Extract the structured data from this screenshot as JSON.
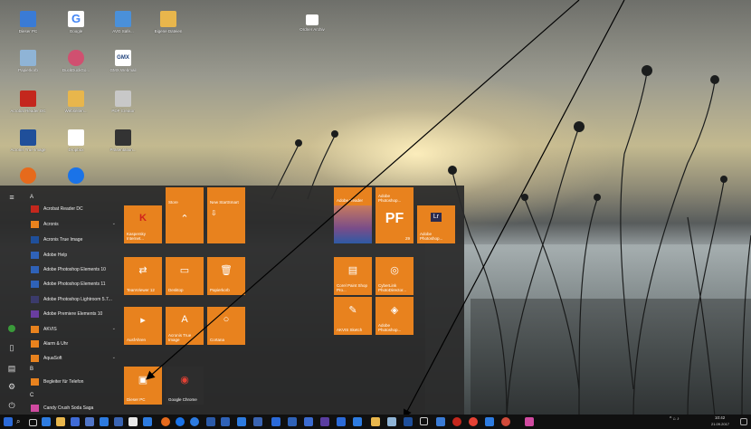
{
  "desktop": {
    "icons": [
      {
        "label": "Dieser PC",
        "color": "#3a7bd5"
      },
      {
        "label": "Google",
        "color": "#ffffff"
      },
      {
        "label": "AVG Safe...",
        "color": "#4a90d9"
      },
      {
        "label": "Eigene Dateien",
        "color": "#e8b64c"
      },
      {
        "label": "Papierkorb",
        "color": "#8fb4d6"
      },
      {
        "label": "DuckDuckGo...",
        "color": "#d05070"
      },
      {
        "label": "GMX Webmail",
        "color": "#ffffff"
      },
      {
        "label": "Acrobat Reader DC",
        "color": "#c4271d"
      },
      {
        "label": "Webseiten...",
        "color": "#e8b64c"
      },
      {
        "label": "PDF Creator",
        "color": "#c8c8c8"
      },
      {
        "label": "Acronis True Image",
        "color": "#1f4f9a"
      },
      {
        "label": "Dropbox",
        "color": "#ffffff"
      },
      {
        "label": "Präsentation...",
        "color": "#333333"
      },
      {
        "label": "Firefox",
        "color": "#e66a1c"
      },
      {
        "label": "TeamViewer",
        "color": "#1a73e8"
      },
      {
        "label": "Ordner Archiv",
        "color": "#ffffff"
      }
    ]
  },
  "start_menu": {
    "letter_a": "A",
    "letter_b": "B",
    "letter_c": "C",
    "apps": [
      {
        "label": "Acrobat Reader DC",
        "chevron": ""
      },
      {
        "label": "Acronis",
        "chevron": "⌄"
      },
      {
        "label": "Acronis True Image",
        "chevron": ""
      },
      {
        "label": "Adobe Help",
        "chevron": ""
      },
      {
        "label": "Adobe Photoshop Elements 10",
        "chevron": ""
      },
      {
        "label": "Adobe Photoshop Elements 11",
        "chevron": ""
      },
      {
        "label": "Adobe Photoshop Lightroom 5.7...",
        "chevron": ""
      },
      {
        "label": "Adobe Premiere Elements 10",
        "chevron": ""
      },
      {
        "label": "AKVIS",
        "chevron": "⌄"
      },
      {
        "label": "Alarm & Uhr",
        "chevron": ""
      },
      {
        "label": "AquaSoft",
        "chevron": "⌄"
      },
      {
        "label": "Begleiter für Telefon",
        "chevron": ""
      },
      {
        "label": "Candy Crush Soda Saga",
        "chevron": ""
      }
    ],
    "tiles": [
      {
        "label": "Store",
        "glyph": ""
      },
      {
        "label": "New StartSmart",
        "glyph": ""
      },
      {
        "label": "Kaspersky Internet...",
        "glyph": "K"
      },
      {
        "label": "",
        "glyph": "⌃"
      },
      {
        "label": "",
        "glyph": "⇩"
      },
      {
        "label": "TeamViewer 12",
        "glyph": "⇄"
      },
      {
        "label": "Desktop",
        "glyph": "▭"
      },
      {
        "label": "Papierkorb",
        "glyph": "🗑"
      },
      {
        "label": "AusfAhren",
        "glyph": "▸"
      },
      {
        "label": "Acronis True Image",
        "glyph": "A"
      },
      {
        "label": "Cortana",
        "glyph": "○"
      },
      {
        "label": "Dieser PC",
        "glyph": "▣"
      },
      {
        "label": "Google Chrome",
        "glyph": "◉"
      },
      {
        "label": "Adobe Reader",
        "glyph": ""
      },
      {
        "label": "Adobe Photoshop...",
        "glyph": ""
      },
      {
        "label": "",
        "glyph": ""
      },
      {
        "label": "29",
        "glyph": "PF"
      },
      {
        "label": "Adobe Photoshop...",
        "glyph": "Lr"
      },
      {
        "label": "Corel Paint Shop Pro...",
        "glyph": "▤"
      },
      {
        "label": "CyberLink PhotoDirector...",
        "glyph": "◎"
      },
      {
        "label": "AKVIS Sketch",
        "glyph": "✎"
      },
      {
        "label": "Adobe Photoshop...",
        "glyph": "◈"
      }
    ]
  },
  "taskbar": {
    "clock_time": "10:42",
    "clock_date": "21.09.2017",
    "tray": "^ ⌂ ♪"
  },
  "colors": {
    "tile": "#e8821e",
    "start_bg": "#2a2a2a",
    "taskbar": "#101010",
    "arrow": "#000000"
  }
}
